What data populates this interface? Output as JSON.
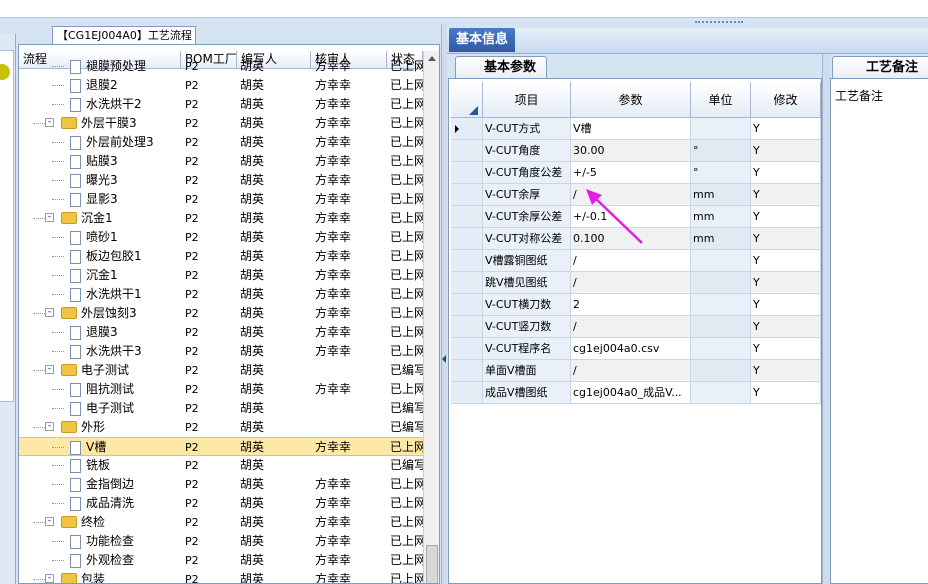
{
  "tree_tab": {
    "label": "【CG1EJ004A0】工艺流程"
  },
  "tree_columns": [
    "流程",
    "BOM工厂",
    "编写人",
    "核审人",
    "状态"
  ],
  "tree_rows": [
    {
      "indent": 2,
      "kind": "doc",
      "label": "褪膜预处理",
      "bom": "P2",
      "writer": "胡英",
      "reviewer": "方幸幸",
      "status": "已上网"
    },
    {
      "indent": 2,
      "kind": "doc",
      "label": "退膜2",
      "bom": "P2",
      "writer": "胡英",
      "reviewer": "方幸幸",
      "status": "已上网"
    },
    {
      "indent": 2,
      "kind": "doc",
      "label": "水洗烘干2",
      "bom": "P2",
      "writer": "胡英",
      "reviewer": "方幸幸",
      "status": "已上网"
    },
    {
      "indent": 1,
      "kind": "folder",
      "label": "外层干膜3",
      "bom": "P2",
      "writer": "胡英",
      "reviewer": "方幸幸",
      "status": "已上网"
    },
    {
      "indent": 2,
      "kind": "doc",
      "label": "外层前处理3",
      "bom": "P2",
      "writer": "胡英",
      "reviewer": "方幸幸",
      "status": "已上网"
    },
    {
      "indent": 2,
      "kind": "doc",
      "label": "贴膜3",
      "bom": "P2",
      "writer": "胡英",
      "reviewer": "方幸幸",
      "status": "已上网"
    },
    {
      "indent": 2,
      "kind": "doc",
      "label": "曝光3",
      "bom": "P2",
      "writer": "胡英",
      "reviewer": "方幸幸",
      "status": "已上网"
    },
    {
      "indent": 2,
      "kind": "doc",
      "label": "显影3",
      "bom": "P2",
      "writer": "胡英",
      "reviewer": "方幸幸",
      "status": "已上网"
    },
    {
      "indent": 1,
      "kind": "folder",
      "label": "沉金1",
      "bom": "P2",
      "writer": "胡英",
      "reviewer": "方幸幸",
      "status": "已上网"
    },
    {
      "indent": 2,
      "kind": "doc",
      "label": "喷砂1",
      "bom": "P2",
      "writer": "胡英",
      "reviewer": "方幸幸",
      "status": "已上网"
    },
    {
      "indent": 2,
      "kind": "doc",
      "label": "板边包胶1",
      "bom": "P2",
      "writer": "胡英",
      "reviewer": "方幸幸",
      "status": "已上网"
    },
    {
      "indent": 2,
      "kind": "doc",
      "label": "沉金1",
      "bom": "P2",
      "writer": "胡英",
      "reviewer": "方幸幸",
      "status": "已上网"
    },
    {
      "indent": 2,
      "kind": "doc",
      "label": "水洗烘干1",
      "bom": "P2",
      "writer": "胡英",
      "reviewer": "方幸幸",
      "status": "已上网"
    },
    {
      "indent": 1,
      "kind": "folder",
      "label": "外层蚀刻3",
      "bom": "P2",
      "writer": "胡英",
      "reviewer": "方幸幸",
      "status": "已上网"
    },
    {
      "indent": 2,
      "kind": "doc",
      "label": "退膜3",
      "bom": "P2",
      "writer": "胡英",
      "reviewer": "方幸幸",
      "status": "已上网"
    },
    {
      "indent": 2,
      "kind": "doc",
      "label": "水洗烘干3",
      "bom": "P2",
      "writer": "胡英",
      "reviewer": "方幸幸",
      "status": "已上网"
    },
    {
      "indent": 1,
      "kind": "folder",
      "label": "电子测试",
      "bom": "P2",
      "writer": "胡英",
      "reviewer": "",
      "status": "已编写"
    },
    {
      "indent": 2,
      "kind": "doc",
      "label": "阻抗测试",
      "bom": "P2",
      "writer": "胡英",
      "reviewer": "方幸幸",
      "status": "已上网"
    },
    {
      "indent": 2,
      "kind": "doc",
      "label": "电子测试",
      "bom": "P2",
      "writer": "胡英",
      "reviewer": "",
      "status": "已编写"
    },
    {
      "indent": 1,
      "kind": "folder",
      "label": "外形",
      "bom": "P2",
      "writer": "胡英",
      "reviewer": "",
      "status": "已编写"
    },
    {
      "indent": 2,
      "kind": "doc",
      "label": "V槽",
      "bom": "P2",
      "writer": "胡英",
      "reviewer": "方幸幸",
      "status": "已上网",
      "selected": true
    },
    {
      "indent": 2,
      "kind": "doc",
      "label": "铣板",
      "bom": "P2",
      "writer": "胡英",
      "reviewer": "",
      "status": "已编写"
    },
    {
      "indent": 2,
      "kind": "doc",
      "label": "金指倒边",
      "bom": "P2",
      "writer": "胡英",
      "reviewer": "方幸幸",
      "status": "已上网"
    },
    {
      "indent": 2,
      "kind": "doc",
      "label": "成品清洗",
      "bom": "P2",
      "writer": "胡英",
      "reviewer": "方幸幸",
      "status": "已上网"
    },
    {
      "indent": 1,
      "kind": "folder",
      "label": "终检",
      "bom": "P2",
      "writer": "胡英",
      "reviewer": "方幸幸",
      "status": "已上网"
    },
    {
      "indent": 2,
      "kind": "doc",
      "label": "功能检查",
      "bom": "P2",
      "writer": "胡英",
      "reviewer": "方幸幸",
      "status": "已上网"
    },
    {
      "indent": 2,
      "kind": "doc",
      "label": "外观检查",
      "bom": "P2",
      "writer": "胡英",
      "reviewer": "方幸幸",
      "status": "已上网"
    },
    {
      "indent": 1,
      "kind": "folder",
      "label": "包装",
      "bom": "P2",
      "writer": "胡英",
      "reviewer": "方幸幸",
      "status": "已上网"
    }
  ],
  "basic_info": {
    "title": "基本信息"
  },
  "params": {
    "tab": "基本参数",
    "columns": [
      "项目",
      "参数",
      "单位",
      "修改"
    ],
    "rows": [
      {
        "item": "V-CUT方式",
        "param": "V槽",
        "unit": "",
        "mod": "Y",
        "current": true
      },
      {
        "item": "V-CUT角度",
        "param": "30.00",
        "unit": "°",
        "mod": "Y"
      },
      {
        "item": "V-CUT角度公差",
        "param": "+/-5",
        "unit": "°",
        "mod": "Y"
      },
      {
        "item": "V-CUT余厚",
        "param": "/",
        "unit": "mm",
        "mod": "Y"
      },
      {
        "item": "V-CUT余厚公差",
        "param": "+/-0.1",
        "unit": "mm",
        "mod": "Y"
      },
      {
        "item": "V-CUT对称公差",
        "param": "0.100",
        "unit": "mm",
        "mod": "Y"
      },
      {
        "item": "V槽露铜图纸",
        "param": "/",
        "unit": "",
        "mod": "Y"
      },
      {
        "item": "跳V槽见图纸",
        "param": "/",
        "unit": "",
        "mod": "Y"
      },
      {
        "item": "V-CUT横刀数",
        "param": "2",
        "unit": "",
        "mod": "Y"
      },
      {
        "item": "V-CUT竖刀数",
        "param": "/",
        "unit": "",
        "mod": "Y"
      },
      {
        "item": "V-CUT程序名",
        "param": "cg1ej004a0.csv",
        "unit": "",
        "mod": "Y"
      },
      {
        "item": "单面V槽面",
        "param": "/",
        "unit": "",
        "mod": "Y"
      },
      {
        "item": "成品V槽图纸",
        "param": "cg1ej004a0_成品V...",
        "unit": "",
        "mod": "Y"
      }
    ]
  },
  "notes": {
    "tab": "工艺备注",
    "label": "工艺备注"
  },
  "colors": {
    "annotation_arrow": "#e020e0",
    "selection": "#fde8a5",
    "tab_active": "#2c5aa3"
  },
  "icons": [
    "folder-icon",
    "document-icon",
    "expand-minus-icon",
    "row-pointer-icon"
  ]
}
